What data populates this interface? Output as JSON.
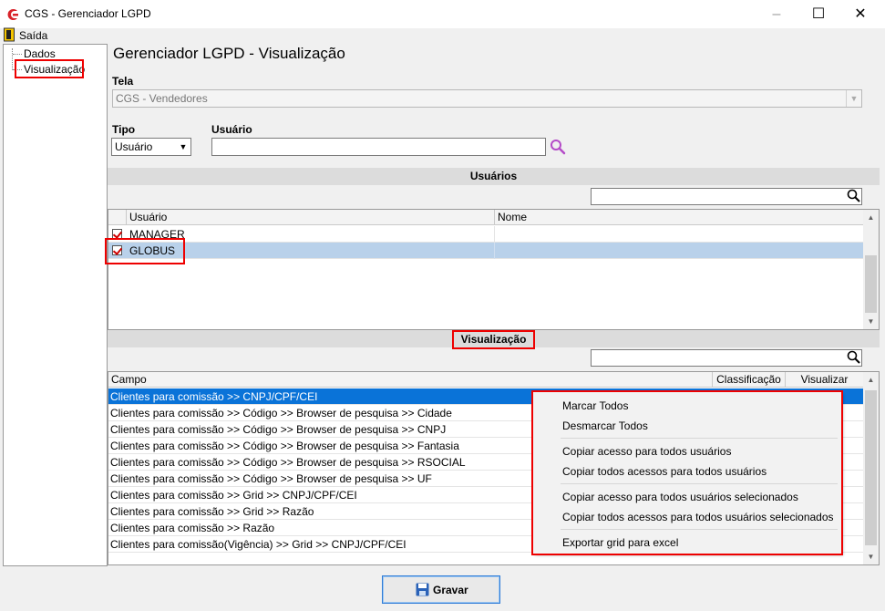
{
  "window": {
    "title": "CGS - Gerenciador LGPD",
    "minimize_glyph": "–",
    "maximize_glyph": "☐",
    "close_glyph": "✕"
  },
  "menu": {
    "exit_label": "Saída"
  },
  "tree": {
    "items": [
      {
        "label": "Dados"
      },
      {
        "label": "Visualização"
      }
    ]
  },
  "page": {
    "title": "Gerenciador LGPD - Visualização"
  },
  "form": {
    "tela_label": "Tela",
    "tela_value": "CGS - Vendedores",
    "tipo_label": "Tipo",
    "tipo_value": "Usuário",
    "usuario_label": "Usuário",
    "usuario_value": ""
  },
  "users_section": {
    "title": "Usuários",
    "columns": [
      "Usuário",
      "Nome"
    ],
    "rows": [
      {
        "checked": true,
        "usuario": "MANAGER",
        "nome": ""
      },
      {
        "checked": true,
        "usuario": "GLOBUS",
        "nome": "",
        "selected": true
      }
    ]
  },
  "view_section": {
    "title": "Visualização",
    "columns": [
      "Campo",
      "Classificação",
      "Visualizar"
    ],
    "rows": [
      "Clientes para comissão >> CNPJ/CPF/CEI",
      "Clientes para comissão >> Código >> Browser de pesquisa >> Cidade",
      "Clientes para comissão >> Código >> Browser de pesquisa >> CNPJ",
      "Clientes para comissão >> Código >> Browser de pesquisa >> Fantasia",
      "Clientes para comissão >> Código >> Browser de pesquisa >> RSOCIAL",
      "Clientes para comissão >> Código >> Browser de pesquisa >> UF",
      "Clientes para comissão >> Grid >> CNPJ/CPF/CEI",
      "Clientes para comissão >> Grid >> Razão",
      "Clientes para comissão >> Razão",
      "Clientes para comissão(Vigência) >> Grid >> CNPJ/CPF/CEI"
    ]
  },
  "context_menu": {
    "items": [
      "Marcar Todos",
      "Desmarcar Todos",
      "Copiar acesso para todos usuários",
      "Copiar todos acessos para todos usuários",
      "Copiar acesso para todos usuários selecionados",
      "Copiar todos acessos para todos usuários selecionados",
      "Exportar grid para excel"
    ]
  },
  "footer": {
    "save_label": "Gravar"
  },
  "colors": {
    "selection": "#0a73d8",
    "highlight_box": "#e00000",
    "row_selected": "#b9d1ea"
  }
}
